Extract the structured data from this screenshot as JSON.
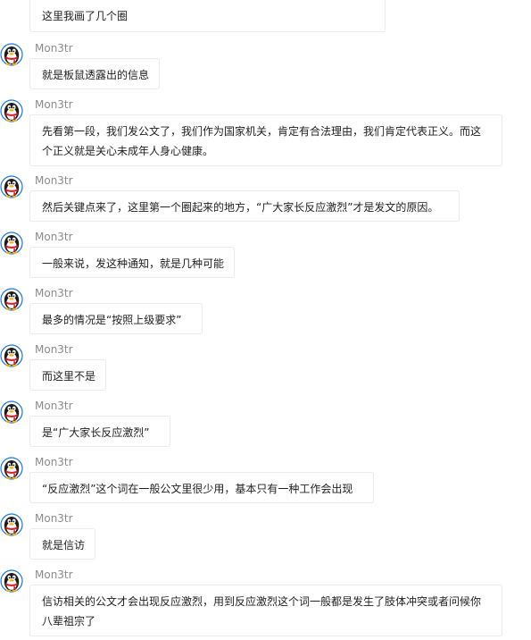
{
  "top_message": {
    "text": "这里我画了几个圈"
  },
  "messages": [
    {
      "sender": "Mon3tr",
      "text": "就是板鼠透露出的信息"
    },
    {
      "sender": "Mon3tr",
      "text": "先看第一段，我们发公文了，我们作为国家机关，肯定有合法理由，我们肯定代表正义。而这个正义就是关心未成年人身心健康。"
    },
    {
      "sender": "Mon3tr",
      "text": "然后关键点来了，这里第一个圈起来的地方，“广大家长反应激烈”才是发文的原因。"
    },
    {
      "sender": "Mon3tr",
      "text": "一般来说，发这种通知，就是几种可能"
    },
    {
      "sender": "Mon3tr",
      "text": "最多的情况是“按照上级要求”"
    },
    {
      "sender": "Mon3tr",
      "text": "而这里不是"
    },
    {
      "sender": "Mon3tr",
      "text": "是“广大家长反应激烈”"
    },
    {
      "sender": "Mon3tr",
      "text": "“反应激烈”这个词在一般公文里很少用，基本只有一种工作会出现"
    },
    {
      "sender": "Mon3tr",
      "text": "就是信访"
    },
    {
      "sender": "Mon3tr",
      "text": "信访相关的公文才会出现反应激烈，用到反应激烈这个词一般都是发生了肢体冲突或者问候你八辈祖宗了"
    }
  ],
  "avatar_icon": "qq-penguin-icon",
  "colors": {
    "sender": "#8c8c8c",
    "bubble_border": "#ebebeb",
    "text": "#1f1f1f",
    "avatar_ring": "#1e78d2",
    "penguin_scarf": "#d9202a",
    "penguin_beak": "#f4b21a"
  }
}
